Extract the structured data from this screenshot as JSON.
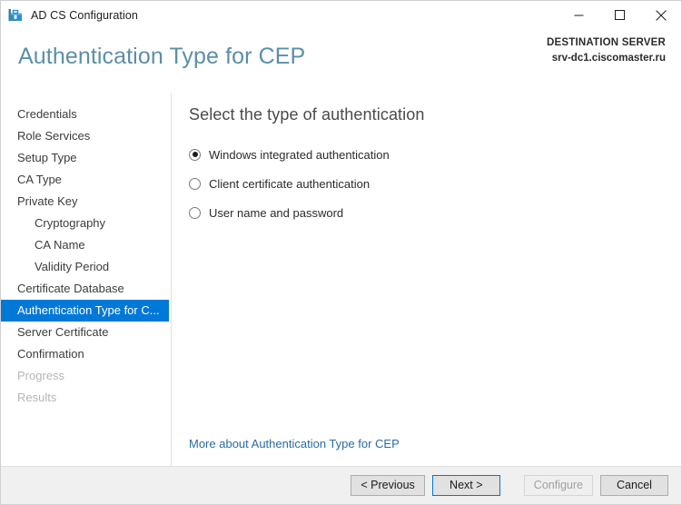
{
  "window": {
    "title": "AD CS Configuration",
    "icon": "adcs-toolbox-icon",
    "controls": {
      "minimize": "minimize-icon",
      "maximize": "maximize-icon",
      "close": "close-icon"
    }
  },
  "header": {
    "page_title": "Authentication Type for CEP",
    "destination_label": "DESTINATION SERVER",
    "destination_server": "srv-dc1.ciscomaster.ru"
  },
  "sidebar": {
    "items": [
      {
        "label": "Credentials",
        "level": 0,
        "state": "normal"
      },
      {
        "label": "Role Services",
        "level": 0,
        "state": "normal"
      },
      {
        "label": "Setup Type",
        "level": 0,
        "state": "normal"
      },
      {
        "label": "CA Type",
        "level": 0,
        "state": "normal"
      },
      {
        "label": "Private Key",
        "level": 0,
        "state": "normal"
      },
      {
        "label": "Cryptography",
        "level": 1,
        "state": "normal"
      },
      {
        "label": "CA Name",
        "level": 1,
        "state": "normal"
      },
      {
        "label": "Validity Period",
        "level": 1,
        "state": "normal"
      },
      {
        "label": "Certificate Database",
        "level": 0,
        "state": "normal"
      },
      {
        "label": "Authentication Type for C...",
        "level": 0,
        "state": "selected"
      },
      {
        "label": "Server Certificate",
        "level": 0,
        "state": "normal"
      },
      {
        "label": "Confirmation",
        "level": 0,
        "state": "normal"
      },
      {
        "label": "Progress",
        "level": 0,
        "state": "disabled"
      },
      {
        "label": "Results",
        "level": 0,
        "state": "disabled"
      }
    ]
  },
  "main": {
    "heading": "Select the type of authentication",
    "options": [
      {
        "label": "Windows integrated authentication",
        "selected": true
      },
      {
        "label": "Client certificate authentication",
        "selected": false
      },
      {
        "label": "User name and password",
        "selected": false
      }
    ],
    "more_link": "More about Authentication Type for CEP"
  },
  "footer": {
    "buttons": [
      {
        "label": "< Previous",
        "state": "normal"
      },
      {
        "label": "Next >",
        "state": "default"
      },
      {
        "label": "Configure",
        "state": "disabled"
      },
      {
        "label": "Cancel",
        "state": "normal"
      }
    ]
  },
  "colors": {
    "accent": "#0078d7",
    "title_text": "#5b8fa8",
    "link": "#2b6ca3",
    "footer_bg": "#f0f0f0"
  }
}
